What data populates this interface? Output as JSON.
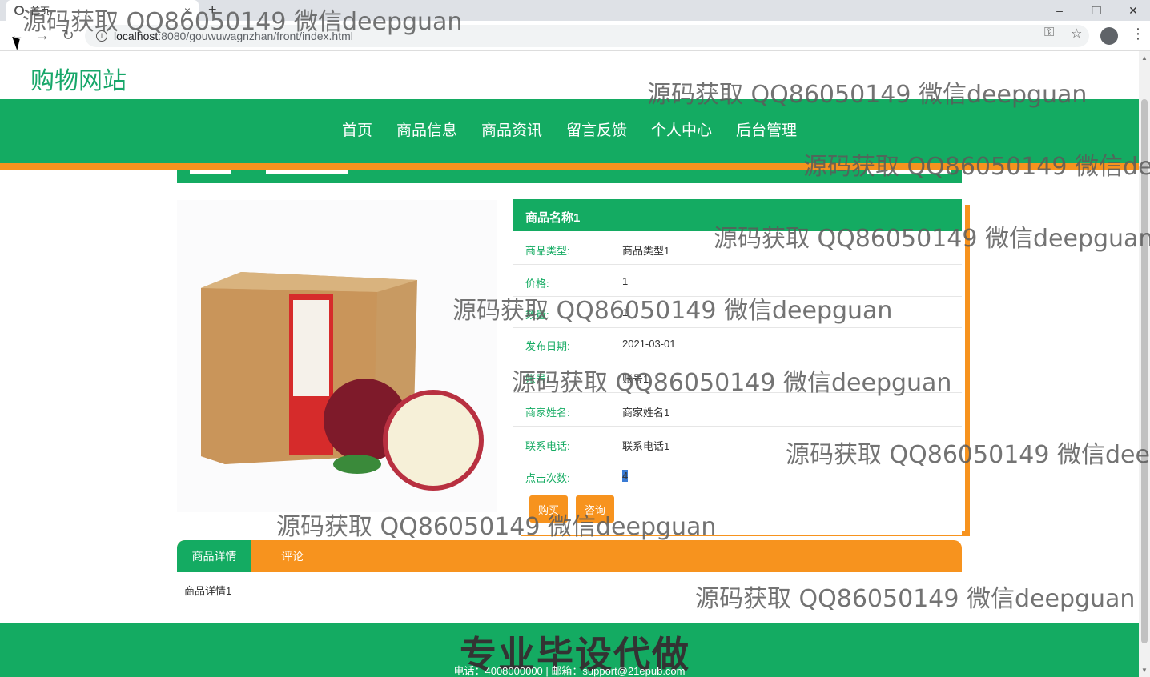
{
  "browser": {
    "tab_title": "首页",
    "tab_close": "×",
    "new_tab": "+",
    "url_host": "localhost",
    "url_path": ":8080/gouwuwagnzhan/front/index.html",
    "win_min": "–",
    "win_max": "❐",
    "win_close": "✕",
    "back": "←",
    "forward": "→",
    "reload": "↻",
    "key": "⚿",
    "star": "☆",
    "menu": "⋮"
  },
  "site": {
    "title": "购物网站",
    "nav": [
      "首页",
      "商品信息",
      "商品资讯",
      "留言反馈",
      "个人中心",
      "后台管理"
    ]
  },
  "product": {
    "name": "商品名称1",
    "fields": [
      {
        "label": "商品类型:",
        "value": "商品类型1"
      },
      {
        "label": "价格:",
        "value": "1"
      },
      {
        "label": "数量:",
        "value": "1"
      },
      {
        "label": "发布日期:",
        "value": "2021-03-01"
      },
      {
        "label": "账号:",
        "value": "账号1"
      },
      {
        "label": "商家姓名:",
        "value": "商家姓名1"
      },
      {
        "label": "联系电话:",
        "value": "联系电话1"
      },
      {
        "label": "点击次数:",
        "value": "4"
      }
    ],
    "buy_label": "购买",
    "consult_label": "咨询"
  },
  "detail_tabs": {
    "tab1": "商品详情",
    "tab2": "评论",
    "content": "商品详情1"
  },
  "footer": {
    "banner": "专业毕设代做",
    "contact": "电话：4008000000 | 邮箱：support@21epub.com"
  },
  "watermark": "源码获取 QQ86050149 微信deepguan",
  "colors": {
    "primary": "#14ab62",
    "accent": "#f7931e"
  }
}
